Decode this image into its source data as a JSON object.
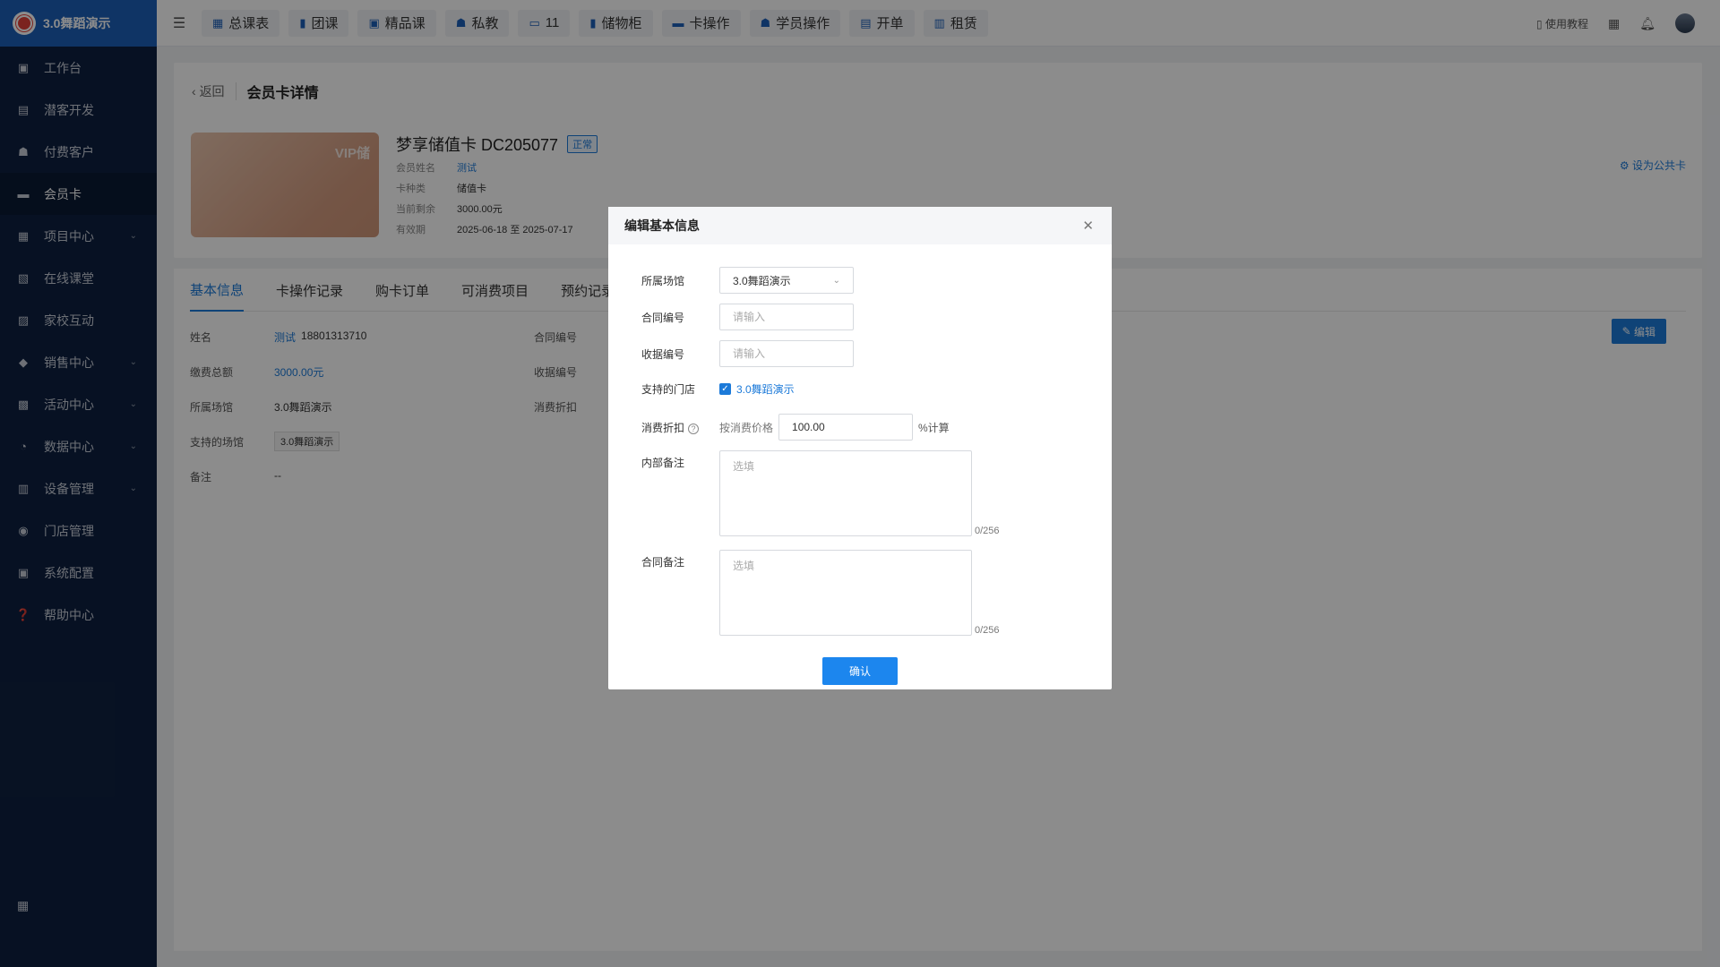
{
  "app": {
    "brand": "3.0舞蹈演示"
  },
  "sidebar": {
    "items": [
      {
        "label": "工作台",
        "icon": "dashboard-icon",
        "glyph": "▣"
      },
      {
        "label": "潜客开发",
        "icon": "id-card-icon",
        "glyph": "▤"
      },
      {
        "label": "付费客户",
        "icon": "users-icon",
        "glyph": "☗"
      },
      {
        "label": "会员卡",
        "icon": "card-icon",
        "glyph": "▬",
        "active": true
      },
      {
        "label": "项目中心",
        "icon": "folder-icon",
        "glyph": "▦",
        "expand": true
      },
      {
        "label": "在线课堂",
        "icon": "briefcase-icon",
        "glyph": "▧"
      },
      {
        "label": "家校互动",
        "icon": "contacts-icon",
        "glyph": "▨"
      },
      {
        "label": "销售中心",
        "icon": "tag-icon",
        "glyph": "◆",
        "expand": true
      },
      {
        "label": "活动中心",
        "icon": "calendar-icon",
        "glyph": "▩",
        "expand": true
      },
      {
        "label": "数据中心",
        "icon": "pie-chart-icon",
        "glyph": "◔",
        "expand": true
      },
      {
        "label": "设备管理",
        "icon": "device-icon",
        "glyph": "▥",
        "expand": true
      },
      {
        "label": "门店管理",
        "icon": "store-icon",
        "glyph": "◉"
      },
      {
        "label": "系统配置",
        "icon": "settings-monitor-icon",
        "glyph": "▣"
      },
      {
        "label": "帮助中心",
        "icon": "help-icon",
        "glyph": "❓"
      }
    ],
    "bottom_icon": "apps-grid-icon"
  },
  "topnav": {
    "items": [
      {
        "label": "总课表",
        "icon": "calendar-icon",
        "glyph": "▦"
      },
      {
        "label": "团课",
        "icon": "book-icon",
        "glyph": "▮"
      },
      {
        "label": "精品课",
        "icon": "star-book-icon",
        "glyph": "▣"
      },
      {
        "label": "私教",
        "icon": "users-icon",
        "glyph": "☗"
      },
      {
        "label": "11",
        "icon": "monitor-icon",
        "glyph": "▭"
      },
      {
        "label": "储物柜",
        "icon": "locker-icon",
        "glyph": "▮"
      },
      {
        "label": "卡操作",
        "icon": "card-icon",
        "glyph": "▬"
      },
      {
        "label": "学员操作",
        "icon": "user-icon",
        "glyph": "☗"
      },
      {
        "label": "开单",
        "icon": "order-icon",
        "glyph": "▤"
      },
      {
        "label": "租赁",
        "icon": "lease-icon",
        "glyph": "▥"
      }
    ],
    "tutorial": "使用教程"
  },
  "page": {
    "back": "返回",
    "title": "会员卡详情",
    "vip_text": "VIP储",
    "card_name": "梦享储值卡 DC205077",
    "status": "正常",
    "meta": [
      {
        "label": "会员姓名",
        "value": "测试",
        "link": true
      },
      {
        "label": "卡种类",
        "value": "储值卡"
      },
      {
        "label": "当前剩余",
        "value": "3000.00元"
      },
      {
        "label": "有效期",
        "value": "2025-06-18 至 2025-07-17"
      }
    ],
    "set_public": "设为公共卡",
    "tabs": [
      "基本信息",
      "卡操作记录",
      "购卡订单",
      "可消费项目",
      "预约记录"
    ],
    "info": {
      "name_label": "姓名",
      "name_value": "测试",
      "phone": "18801313710",
      "paid_label": "缴费总额",
      "paid_value": "3000.00元",
      "venue_label": "所属场馆",
      "venue_value": "3.0舞蹈演示",
      "support_label": "支持的场馆",
      "support_value": "3.0舞蹈演示",
      "remark_label": "备注",
      "remark_value": "--",
      "contract_label": "合同编号",
      "receipt_label": "收据编号",
      "discount_label": "消费折扣"
    },
    "edit_button": "编辑"
  },
  "modal": {
    "title": "编辑基本信息",
    "venue": {
      "label": "所属场馆",
      "value": "3.0舞蹈演示"
    },
    "contract": {
      "label": "合同编号",
      "placeholder": "请输入"
    },
    "receipt": {
      "label": "收据编号",
      "placeholder": "请输入"
    },
    "stores": {
      "label": "支持的门店",
      "option": "3.0舞蹈演示",
      "checked": true
    },
    "discount": {
      "label": "消费折扣",
      "prefix": "按消费价格",
      "value": "100.00",
      "suffix": "%计算"
    },
    "internal_note": {
      "label": "内部备注",
      "placeholder": "选填",
      "counter": "0/256"
    },
    "contract_note": {
      "label": "合同备注",
      "placeholder": "选填",
      "counter": "0/256"
    },
    "confirm": "确认"
  }
}
